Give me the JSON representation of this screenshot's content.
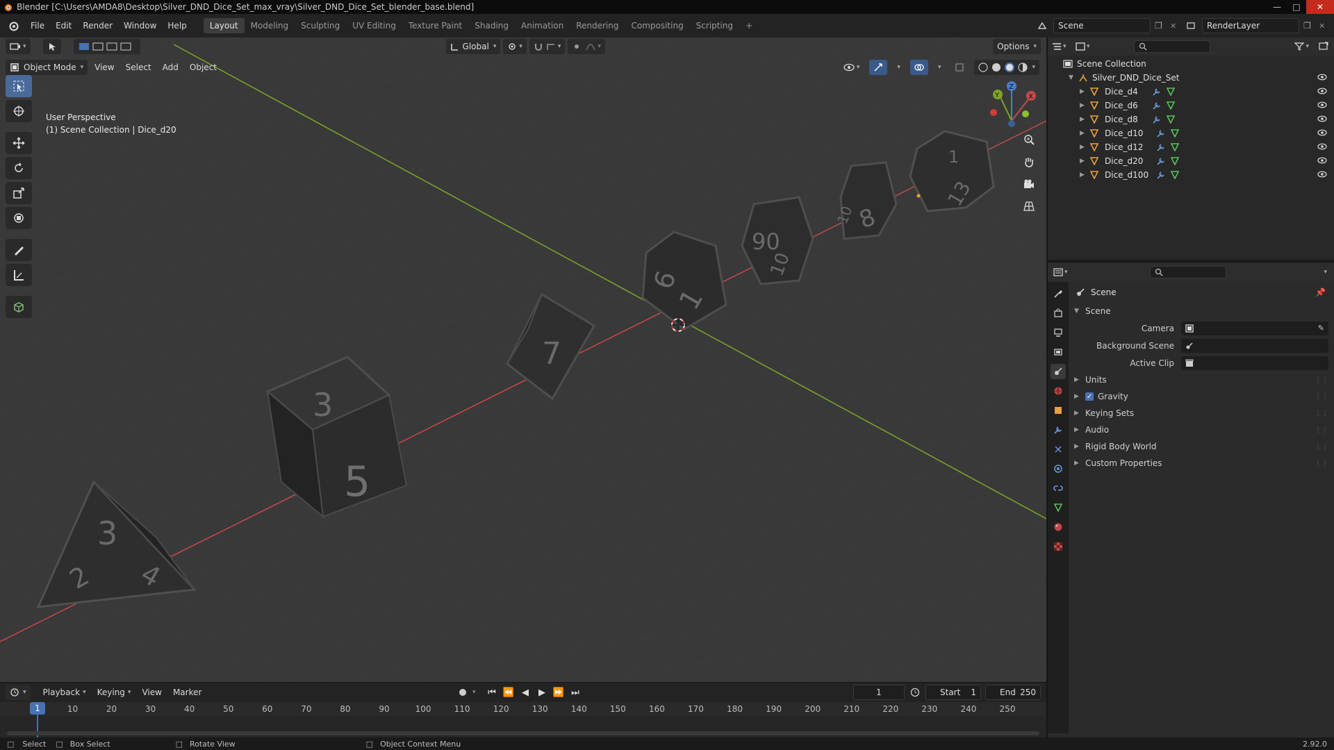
{
  "window": {
    "title": "Blender [C:\\Users\\AMDA8\\Desktop\\Silver_DND_Dice_Set_max_vray\\Silver_DND_Dice_Set_blender_base.blend]"
  },
  "menu": [
    "File",
    "Edit",
    "Render",
    "Window",
    "Help"
  ],
  "workspaces": [
    "Layout",
    "Modeling",
    "Sculpting",
    "UV Editing",
    "Texture Paint",
    "Shading",
    "Animation",
    "Rendering",
    "Compositing",
    "Scripting"
  ],
  "workspace_add": "+",
  "topbar_right": {
    "scene": "Scene",
    "view_layer": "RenderLayer"
  },
  "viewport": {
    "mode": "Object Mode",
    "menus": [
      "View",
      "Select",
      "Add",
      "Object"
    ],
    "transform_orientation": "Global",
    "options_label": "Options",
    "overlay_line1": "User Perspective",
    "overlay_line2": "(1) Scene Collection | Dice_d20",
    "gizmo": {
      "x": "X",
      "y": "Y",
      "z": "Z"
    },
    "dice_numbers": {
      "d4": [
        "3",
        "2",
        "4"
      ],
      "d6": [
        "3",
        "5"
      ],
      "d8": [
        "7"
      ],
      "d10": [
        "6",
        "1"
      ],
      "d12": [
        "90",
        "10"
      ],
      "d20": [
        "8",
        "10"
      ],
      "d100": [
        "13",
        "1"
      ]
    }
  },
  "timeline": {
    "menus": [
      "Playback",
      "Keying",
      "View",
      "Marker"
    ],
    "current_frame": "1",
    "start_label": "Start",
    "start": "1",
    "end_label": "End",
    "end": "250",
    "ticks": [
      "10",
      "20",
      "30",
      "40",
      "50",
      "60",
      "70",
      "80",
      "90",
      "100",
      "110",
      "120",
      "130",
      "140",
      "150",
      "160",
      "170",
      "180",
      "190",
      "200",
      "210",
      "220",
      "230",
      "240",
      "250"
    ]
  },
  "statusbar": {
    "select": "Select",
    "box_select": "Box Select",
    "rotate": "Rotate View",
    "context": "Object Context Menu",
    "version": "2.92.0"
  },
  "outliner": {
    "root": "Scene Collection",
    "collection": "Silver_DND_Dice_Set",
    "objects": [
      "Dice_d4",
      "Dice_d6",
      "Dice_d8",
      "Dice_d10",
      "Dice_d12",
      "Dice_d20",
      "Dice_d100"
    ]
  },
  "properties": {
    "breadcrumb": "Scene",
    "panel": "Scene",
    "fields": [
      {
        "label": "Camera",
        "value": ""
      },
      {
        "label": "Background Scene",
        "value": ""
      },
      {
        "label": "Active Clip",
        "value": ""
      }
    ],
    "subpanels": [
      {
        "label": "Units",
        "checkbox": false
      },
      {
        "label": "Gravity",
        "checkbox": true
      },
      {
        "label": "Keying Sets",
        "checkbox": false
      },
      {
        "label": "Audio",
        "checkbox": false
      },
      {
        "label": "Rigid Body World",
        "checkbox": false
      },
      {
        "label": "Custom Properties",
        "checkbox": false
      }
    ]
  },
  "colors": {
    "accent": "#4772b3",
    "x_axis": "#c34a4a",
    "y_axis": "#7ea52a",
    "dice": "#2a2a2a"
  }
}
